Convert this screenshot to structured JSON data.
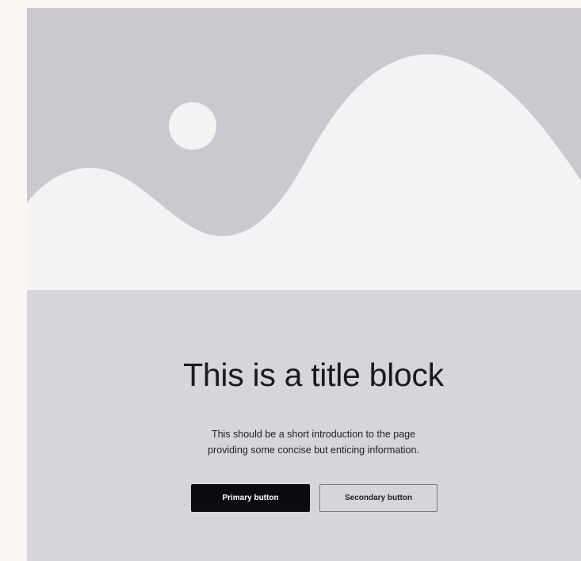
{
  "hero": {
    "placeholder_icon": "image-placeholder-icon",
    "background_color": "#c9cacf",
    "shape_color": "#f3f3f4"
  },
  "title_block": {
    "title": "This is a title block",
    "intro_line_1": "This should be a short introduction to the page",
    "intro_line_2": "providing some concise but enticing information."
  },
  "buttons": {
    "primary_label": "Primary button",
    "secondary_label": "Secondary button"
  },
  "colors": {
    "page_background": "#f9f6f4",
    "section_background": "#d5d5da",
    "primary_button": "#0c0c10",
    "text": "#1b1b1f"
  }
}
